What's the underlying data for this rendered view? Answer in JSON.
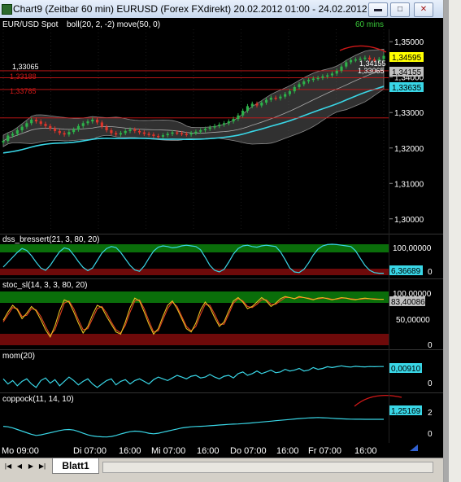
{
  "window": {
    "title": "Chart9 (Zeitbar 60 min)  EURUSD (Forex FXdirekt) 20.02.2012 01:00 - 24.02.2012 ...",
    "buttons": [
      "▬",
      "□",
      "✕"
    ]
  },
  "price_panel": {
    "legend_symbol": "EUR/USD Spot",
    "legend_indicators": "boll(20, 2, -2) move(50, 0)",
    "timeframe": "60 mins",
    "y_ticks": [
      "1,35000",
      "1,34000",
      "1,33000",
      "1,32000",
      "1,31000",
      "1,30000"
    ],
    "badges": [
      "1,34595",
      "1,34155",
      "1,33635"
    ],
    "inline_labels": [
      "1,33065",
      "1,34155",
      "1,33188",
      "1,33065",
      "1,33785"
    ]
  },
  "dss_panel": {
    "legend": "dss_bressert(21, 3, 80, 20)",
    "y_ticks": [
      "100,00000",
      "0"
    ],
    "badge": "6,36689"
  },
  "stoc_panel": {
    "legend": "stoc_sl(14, 3, 3, 80, 20)",
    "y_ticks": [
      "100,00000",
      "50,00000",
      "0"
    ],
    "badge": "83,40086"
  },
  "mom_panel": {
    "legend": "mom(20)",
    "y_ticks": [
      "0"
    ],
    "badge": "0,00910"
  },
  "coppock_panel": {
    "legend": "coppock(11, 14, 10)",
    "y_ticks": [
      "2",
      "0"
    ],
    "badge": "1,25169"
  },
  "x_axis": {
    "labels": [
      "Mo  09:00",
      "Di  07:00",
      "16:00",
      "Mi  07:00",
      "16:00",
      "Do  07:00",
      "16:00",
      "Fr  07:00",
      "16:00"
    ]
  },
  "tabs": {
    "sheet": "Blatt1",
    "nav": [
      "|◀",
      "◀",
      "▶",
      "▶|"
    ]
  },
  "colors": {
    "background": "#000000",
    "candle_up": "#2db34a",
    "candle_down": "#e0342a",
    "bollinger_band": "#5a5a5a",
    "moving_average": "#39d6e6",
    "axis_text": "#ffffff",
    "legend_text": "#ffffff",
    "timeframe_text": "#38c838",
    "overbought_zone": "#0a6e0a",
    "oversold_zone": "#6e0a0a",
    "indicator_line": "#39d6e6",
    "stoc_slow_line": "#e8c020",
    "stoc_fast_line": "#e04020",
    "annotation": "#d01818",
    "badge_price": "#ffff00",
    "badge_band": "#c0c0c0",
    "badge_ma": "#39d6e6"
  },
  "chart_data": [
    {
      "type": "candlestick",
      "title": "EUR/USD Spot",
      "ylim": [
        1.2965,
        1.3535
      ],
      "x_labels": [
        "Mo 09:00",
        "Di 07:00",
        "16:00",
        "Mi 07:00",
        "16:00",
        "Do 07:00",
        "16:00",
        "Fr 07:00",
        "16:00"
      ],
      "close": [
        1.322,
        1.3235,
        1.324,
        1.325,
        1.326,
        1.327,
        1.328,
        1.3275,
        1.3268,
        1.3262,
        1.3255,
        1.3248,
        1.3242,
        1.3238,
        1.3245,
        1.3252,
        1.3262,
        1.327,
        1.3275,
        1.328,
        1.3272,
        1.326,
        1.325,
        1.3242,
        1.3238,
        1.3242,
        1.3248,
        1.3252,
        1.3248,
        1.3244,
        1.324,
        1.3238,
        1.3234,
        1.3232,
        1.3236,
        1.324,
        1.3244,
        1.3242,
        1.324,
        1.3238,
        1.3242,
        1.3246,
        1.325,
        1.3254,
        1.3258,
        1.3262,
        1.3266,
        1.327,
        1.3275,
        1.3282,
        1.3292,
        1.3305,
        1.3318,
        1.3325,
        1.332,
        1.3328,
        1.3336,
        1.3342,
        1.334,
        1.3345,
        1.3352,
        1.336,
        1.3372,
        1.338,
        1.3388,
        1.3392,
        1.3396,
        1.3398,
        1.3402,
        1.3405,
        1.341,
        1.3418,
        1.343,
        1.3442,
        1.3448,
        1.345,
        1.3452,
        1.3455,
        1.345,
        1.3448,
        1.3451,
        1.346
      ],
      "bollinger": {
        "period": 20,
        "upper": 2,
        "lower": -2
      },
      "moving_average": {
        "period": 50
      },
      "horizontal_lines": [
        1.3418,
        1.3398,
        1.3365,
        1.3285
      ],
      "last_price": 1.34595,
      "band_value": 1.34155,
      "ma_value": 1.33635
    },
    {
      "type": "line",
      "title": "dss_bressert(21, 3, 80, 20)",
      "ylim": [
        0,
        100
      ],
      "zones": {
        "upper": 80,
        "lower": 20
      },
      "series": [
        {
          "values": [
            25,
            40,
            55,
            70,
            82,
            76,
            60,
            40,
            22,
            15,
            30,
            52,
            72,
            84,
            80,
            62,
            42,
            24,
            14,
            22,
            45,
            68,
            82,
            88,
            85,
            70,
            50,
            30,
            16,
            12,
            28,
            52,
            74,
            86,
            90,
            88,
            84,
            86,
            90,
            92,
            90,
            88,
            78,
            55,
            30,
            15,
            10,
            18,
            40,
            65,
            82,
            90,
            92,
            88,
            86,
            90,
            92,
            90,
            88,
            72,
            48,
            22,
            10,
            8,
            18,
            38,
            62,
            80,
            90,
            94,
            95,
            94,
            92,
            90,
            88,
            75,
            52,
            30,
            15,
            8,
            6,
            6
          ]
        }
      ],
      "last_value": 6.36689
    },
    {
      "type": "line",
      "title": "stoc_sl(14, 3, 3, 80, 20)",
      "ylim": [
        0,
        100
      ],
      "zones": {
        "upper": 80,
        "lower": 20
      },
      "series": [
        {
          "values": [
            45,
            60,
            72,
            64,
            48,
            58,
            70,
            62,
            46,
            28,
            15,
            35,
            62,
            82,
            78,
            60,
            40,
            22,
            34,
            55,
            72,
            68,
            52,
            38,
            24,
            20,
            42,
            68,
            85,
            80,
            60,
            38,
            20,
            30,
            52,
            72,
            80,
            66,
            48,
            30,
            24,
            40,
            64,
            78,
            68,
            50,
            34,
            42,
            62,
            80,
            86,
            78,
            66,
            70,
            78,
            86,
            80,
            70,
            76,
            84,
            88,
            86,
            84,
            88,
            86,
            84,
            82,
            85,
            86,
            84,
            82,
            84,
            86,
            85,
            83,
            82,
            84,
            85,
            84,
            83,
            83,
            83
          ]
        },
        {
          "values": [
            42,
            55,
            68,
            66,
            52,
            54,
            66,
            64,
            52,
            34,
            18,
            28,
            52,
            76,
            80,
            66,
            46,
            28,
            30,
            48,
            66,
            70,
            58,
            42,
            28,
            22,
            36,
            60,
            80,
            82,
            66,
            44,
            24,
            26,
            46,
            66,
            78,
            70,
            52,
            34,
            26,
            34,
            56,
            74,
            72,
            56,
            38,
            38,
            56,
            76,
            84,
            80,
            70,
            68,
            74,
            82,
            82,
            74,
            74,
            80,
            86,
            86,
            84,
            86,
            86,
            85,
            83,
            84,
            85,
            85,
            83,
            83,
            85,
            85,
            84,
            83,
            83,
            84,
            84,
            84,
            83,
            83
          ]
        }
      ],
      "last_value": 83.40086
    },
    {
      "type": "line",
      "title": "mom(20)",
      "series": [
        {
          "values": [
            0.002,
            -0.001,
            0.001,
            -0.002,
            0.0005,
            0.002,
            -0.001,
            -0.003,
            0.001,
            0.0025,
            -0.0005,
            0.0015,
            -0.002,
            0.0005,
            0.003,
            0.001,
            -0.0015,
            0.0005,
            0.002,
            -0.001,
            -0.003,
            -0.001,
            0.001,
            0.002,
            -0.0015,
            0.0005,
            0.0015,
            -0.001,
            0.001,
            0.002,
            0.0005,
            -0.001,
            0.0015,
            0.003,
            0.002,
            0.001,
            0.0025,
            0.004,
            0.003,
            0.002,
            0.0035,
            0.004,
            0.0025,
            0.003,
            0.0045,
            0.003,
            0.002,
            0.0035,
            0.004,
            0.0025,
            0.005,
            0.006,
            0.004,
            0.005,
            0.0065,
            0.005,
            0.006,
            0.007,
            0.0055,
            0.006,
            0.0075,
            0.0065,
            0.007,
            0.008,
            0.0065,
            0.007,
            0.0085,
            0.0075,
            0.008,
            0.009,
            0.0085,
            0.009,
            0.0095,
            0.009,
            0.0088,
            0.0092,
            0.009,
            0.0089,
            0.0091,
            0.009,
            0.0091,
            0.0091
          ]
        }
      ],
      "last_value": 0.0091
    },
    {
      "type": "line",
      "title": "coppock(11, 14, 10)",
      "ylim": [
        -0.8,
        3.0
      ],
      "series": [
        {
          "values": [
            0.6,
            0.55,
            0.45,
            0.3,
            0.15,
            0.0,
            -0.15,
            -0.25,
            -0.2,
            -0.1,
            0.0,
            0.1,
            0.2,
            0.28,
            0.3,
            0.25,
            0.12,
            -0.05,
            -0.2,
            -0.3,
            -0.35,
            -0.38,
            -0.4,
            -0.35,
            -0.25,
            -0.12,
            0.0,
            0.1,
            0.15,
            0.12,
            0.05,
            -0.05,
            -0.1,
            -0.05,
            0.05,
            0.15,
            0.25,
            0.35,
            0.45,
            0.5,
            0.55,
            0.58,
            0.6,
            0.62,
            0.65,
            0.68,
            0.72,
            0.75,
            0.78,
            0.8,
            0.82,
            0.85,
            0.88,
            0.92,
            0.96,
            1.0,
            1.04,
            1.08,
            1.12,
            1.16,
            1.2,
            1.24,
            1.28,
            1.32,
            1.35,
            1.38,
            1.4,
            1.42,
            1.4,
            1.38,
            1.35,
            1.32,
            1.3,
            1.28,
            1.27,
            1.26,
            1.26,
            1.25,
            1.25,
            1.25,
            1.25,
            1.2517
          ]
        }
      ],
      "last_value": 1.25169
    }
  ]
}
